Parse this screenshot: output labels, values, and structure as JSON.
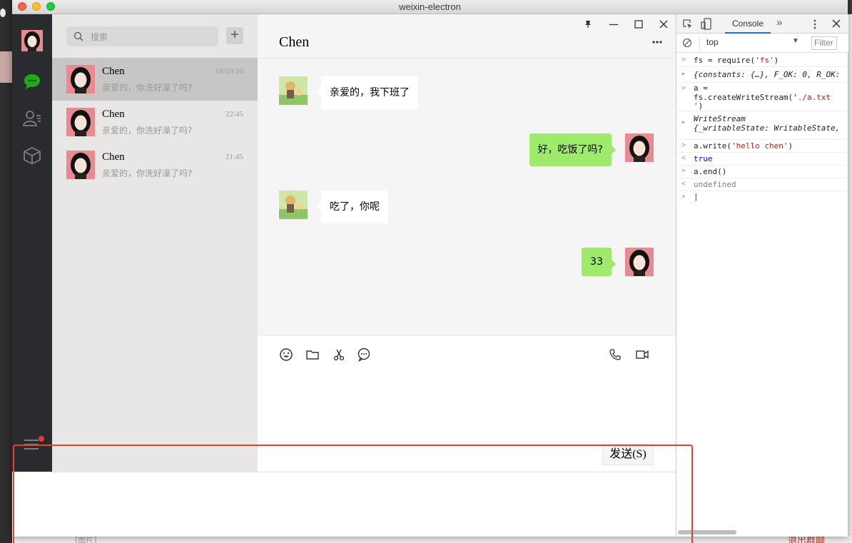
{
  "window": {
    "title": "weixin-electron"
  },
  "search": {
    "placeholder": "搜索"
  },
  "sessions": [
    {
      "name": "Chen",
      "time": "18/10/10",
      "message": "亲爱的，你洗好澡了吗?"
    },
    {
      "name": "Chen",
      "time": "22:45",
      "message": "亲爱的，你洗好澡了吗?"
    },
    {
      "name": "Chen",
      "time": "21:45",
      "message": "亲爱的，你洗好澡了吗?"
    }
  ],
  "chat": {
    "title": "Chen",
    "messages": [
      {
        "side": "left",
        "text": "亲爱的，我下班了"
      },
      {
        "side": "right",
        "text": "好，吃饭了吗?"
      },
      {
        "side": "left",
        "text": "吃了，你呢"
      },
      {
        "side": "right",
        "text": "33"
      }
    ],
    "send_label": "发送(S)"
  },
  "devtools": {
    "tab": "Console",
    "context": "top",
    "filter_placeholder": "Filter",
    "lines": [
      {
        "arrow": ">",
        "text": "fs = require('fs')"
      },
      {
        "arrow": "▸",
        "text": "{constants: {…}, F_OK: 0, R_OK:"
      },
      {
        "arrow": ">",
        "text": "a =\nfs.createWriteStream('./a.txt\n')"
      },
      {
        "arrow": "▸",
        "text": "WriteStream\n{_writableState: WritableState,"
      },
      {
        "arrow": ">",
        "text": "a.write('hello chen')"
      },
      {
        "arrow": "<",
        "text": "true"
      },
      {
        "arrow": ">",
        "text": "a.end()"
      },
      {
        "arrow": "<",
        "text": "undefined"
      }
    ]
  },
  "background": {
    "bottom_text": "[图片]",
    "bottom_right": "退出群聊"
  },
  "colors": {
    "nav_bg": "#2a2b2f",
    "list_bg": "#e9e7e5",
    "bubble_self": "#9eea6a",
    "highlight": "#e8402f",
    "wechat_green": "#1aad19"
  }
}
